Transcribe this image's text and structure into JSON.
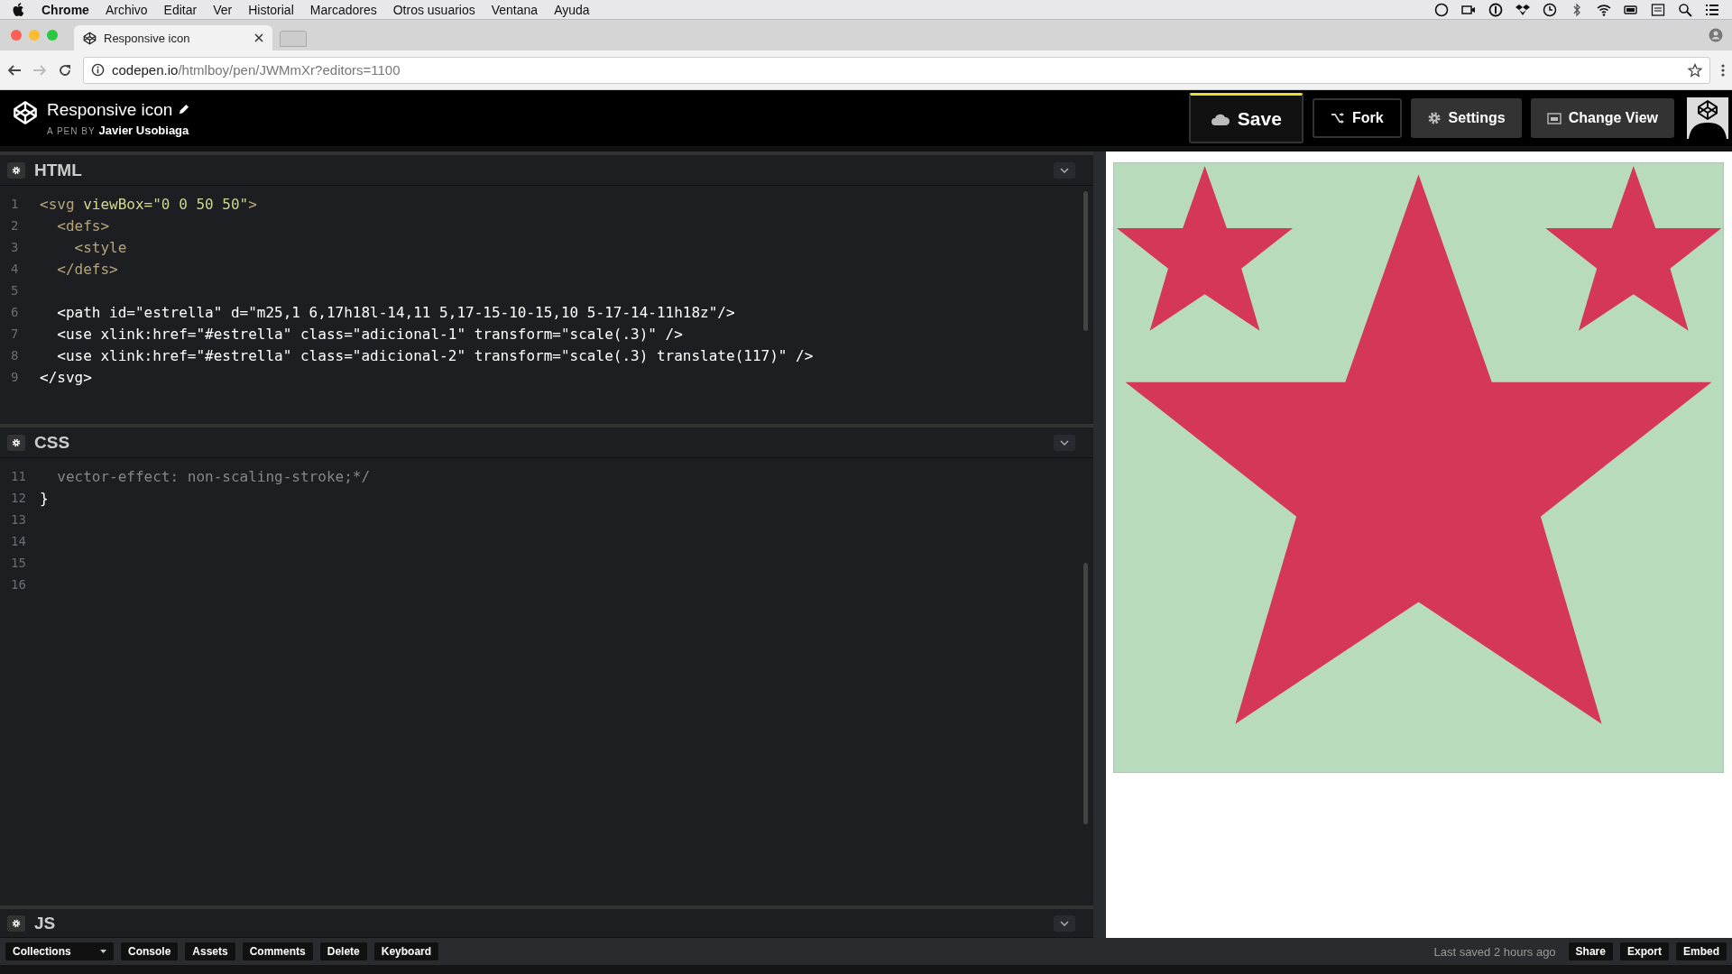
{
  "menubar": {
    "app": "Chrome",
    "items": [
      "Archivo",
      "Editar",
      "Ver",
      "Historial",
      "Marcadores",
      "Otros usuarios",
      "Ventana",
      "Ayuda"
    ]
  },
  "browser_tab": {
    "title": "Responsive icon"
  },
  "address_bar": {
    "domain": "codepen.io",
    "path": "/htmlboy/pen/JWMmXr?editors=1100"
  },
  "pen": {
    "title": "Responsive icon",
    "byline": "A PEN BY",
    "author": "Javier Usobiaga"
  },
  "header_buttons": [
    {
      "label": "Save",
      "kind": "save"
    },
    {
      "label": "Fork",
      "kind": "fork"
    },
    {
      "label": "Settings",
      "kind": "settings"
    },
    {
      "label": "Change View",
      "kind": "view"
    }
  ],
  "editors": [
    {
      "title": "HTML",
      "lines": [
        {
          "number": "1",
          "tokens": [
            {
              "kind": "tag",
              "text": "<svg "
            },
            {
              "kind": "attr",
              "text": "viewBox="
            },
            {
              "kind": "string",
              "text": "\"0 0 50 50\""
            },
            {
              "kind": "tag",
              "text": ">"
            }
          ]
        },
        {
          "number": "2",
          "tokens": [
            {
              "kind": "tag",
              "text": "  <defs>"
            }
          ]
        },
        {
          "number": "3",
          "tokens": [
            {
              "kind": "tag",
              "text": "    <style"
            }
          ]
        },
        {
          "number": "4",
          "tokens": [
            {
              "kind": "tag",
              "text": "  </defs>"
            }
          ]
        },
        {
          "number": "5"
        },
        {
          "number": "6",
          "tokens": [
            {
              "kind": "plain",
              "text": "  <path id=\"estrella\" d=\"m25,1 6,17h18l-14,11 5,17-15-10-15,10 5-17-14-11h18z\"/>"
            }
          ]
        },
        {
          "number": "7",
          "tokens": [
            {
              "kind": "plain",
              "text": "  <use xlink:href=\"#estrella\" class=\"adicional-1\" transform=\"scale(.3)\" />"
            }
          ]
        },
        {
          "number": "8",
          "tokens": [
            {
              "kind": "plain",
              "text": "  <use xlink:href=\"#estrella\" class=\"adicional-2\" transform=\"scale(.3) translate(117)\" />"
            }
          ]
        },
        {
          "number": "9",
          "tokens": [
            {
              "kind": "plain",
              "text": "</svg>"
            }
          ]
        }
      ]
    },
    {
      "title": "CSS",
      "lines": [
        {
          "number": "11",
          "tokens": [
            {
              "kind": "comment",
              "text": "  vector-effect: non-scaling-stroke;*/"
            }
          ]
        },
        {
          "number": "12",
          "tokens": [
            {
              "kind": "plain",
              "text": "}"
            }
          ]
        },
        {
          "number": "13"
        },
        {
          "number": "14"
        },
        {
          "number": "15"
        },
        {
          "number": "16"
        }
      ]
    },
    {
      "title": "JS"
    }
  ],
  "footer": {
    "left_buttons": [
      {
        "label": "Collections",
        "kind": "dropdown"
      },
      {
        "label": "Console",
        "kind": "plain"
      },
      {
        "label": "Assets",
        "kind": "plain"
      },
      {
        "label": "Comments",
        "kind": "plain"
      },
      {
        "label": "Delete",
        "kind": "plain"
      },
      {
        "label": "Keyboard",
        "kind": "plain"
      }
    ],
    "status": "Last saved 2 hours ago",
    "right_buttons": [
      "Share",
      "Export",
      "Embed"
    ]
  },
  "preview": {
    "kind": "stars"
  }
}
